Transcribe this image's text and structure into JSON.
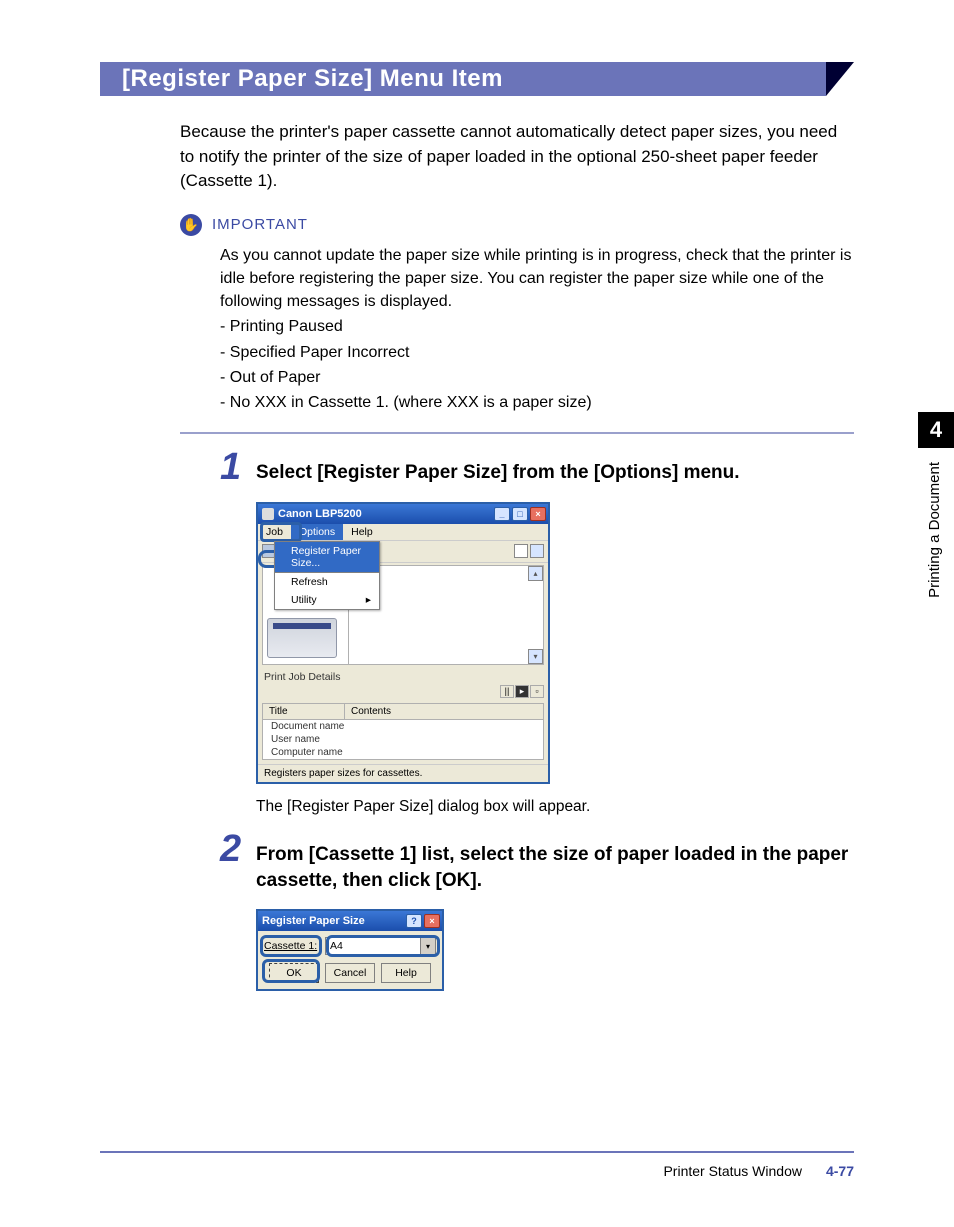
{
  "titleBar": "[Register Paper Size] Menu Item",
  "intro": "Because the printer's paper cassette cannot automatically detect paper sizes, you need to notify the printer of the size of paper loaded in the optional 250-sheet paper feeder (Cassette 1).",
  "important": {
    "label": "IMPORTANT",
    "body": "As you cannot update the paper size while printing is in progress, check that the printer is idle before registering the paper size. You can register the paper size while one of the following messages is displayed.",
    "items": [
      "- Printing Paused",
      "- Specified Paper Incorrect",
      "- Out of Paper",
      "- No XXX in Cassette 1. (where XXX is a paper size)"
    ]
  },
  "step1": {
    "num": "1",
    "heading": "Select [Register Paper Size] from the [Options] menu.",
    "screenshot": {
      "title": "Canon LBP5200",
      "menu": {
        "job": "Job",
        "options": "Options",
        "help": "Help"
      },
      "dropdown": {
        "register": "Register Paper Size...",
        "refresh": "Refresh",
        "utility": "Utility"
      },
      "section": "Print Job Details",
      "tableHead": {
        "title": "Title",
        "contents": "Contents"
      },
      "rows": [
        "Document name",
        "User name",
        "Computer name"
      ],
      "status": "Registers paper sizes for cassettes."
    },
    "note": "The [Register Paper Size] dialog box will appear."
  },
  "step2": {
    "num": "2",
    "heading": "From [Cassette 1] list, select the size of paper loaded in the paper cassette, then click [OK].",
    "dialog": {
      "title": "Register Paper Size",
      "label": "Cassette 1:",
      "value": "A4",
      "ok": "OK",
      "cancel": "Cancel",
      "help": "Help"
    }
  },
  "sideTab": {
    "num": "4",
    "label": "Printing a Document"
  },
  "footer": {
    "section": "Printer Status Window",
    "page": "4-77"
  }
}
